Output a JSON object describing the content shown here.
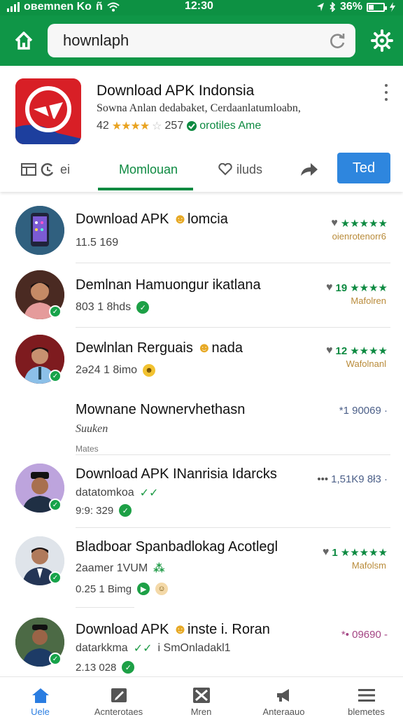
{
  "status_bar": {
    "carrier": "oвemnen Ko",
    "extra": "ñ",
    "time": "12:30",
    "battery": "36%",
    "battery_level": 0.36
  },
  "app_bar": {
    "search_value": "hownlaph"
  },
  "app": {
    "title": "Download APK Indonsia",
    "subtitle": "Sowna Anlan dedabaket, Cerdaanlatumloabn,",
    "rating": "42",
    "stars": "★★★★",
    "extra_star": "☆",
    "count": "257",
    "badge": "orotiles Ame"
  },
  "tabs": [
    {
      "label": "ei"
    },
    {
      "label": "Momlouan"
    },
    {
      "label": "iluds"
    },
    {
      "label": ""
    }
  ],
  "test_button": "Ted",
  "list": [
    {
      "title": "Download APK ",
      "title_emoji": "☻",
      "title_tail": "lomcia",
      "line2": "11.5 169",
      "rating_value": "",
      "rating_stars": "★★★★★",
      "rating_sub": "oienrotenorr6"
    },
    {
      "title": "Demlnan Hamuongur ikatlana",
      "line2": "803 1 8hds",
      "rating_value": "19",
      "rating_stars": "★★★★",
      "rating_sub": "Mafolren"
    },
    {
      "title": "Dewlnlan Rerguais ",
      "title_emoji": "☻",
      "title_tail": "nada",
      "line2": "2ə24 1 8imo",
      "rating_value": "12",
      "rating_stars": "★★★★",
      "rating_sub": "Wafolnanl"
    },
    {
      "title": "Mownane Nownervhethasn",
      "line2": "Suuken",
      "line3": "Mates",
      "rating_value": "*1 90069 ·"
    },
    {
      "title": "Download APK INanrisia Idarcks",
      "line2": "datatomkoa",
      "line2_tail": "✓✓",
      "line3": "9:9: 329",
      "rating_value": "1,51K9 8ł3 ·"
    },
    {
      "title": "Bladboar Spanbadlokag Acotlegl",
      "line2": "2aamer 1VUM",
      "line3": "0.25 1 Bimg",
      "rating_value": "1",
      "rating_stars": "★★★★★",
      "rating_sub": "Mafolsm"
    },
    {
      "title": "Download APK ",
      "title_emoji": "☻",
      "title_tail": "inste i. Roran",
      "line2": "datarkkma",
      "line2_tail": "✓✓",
      "line2_more": "i SmOnladakl1",
      "line3": "2.13 028",
      "rating_value": "*• 09690 -"
    }
  ],
  "bottom_nav": [
    {
      "label": "Uele",
      "icon": "home-icon",
      "active": true
    },
    {
      "label": "Acnterotaes",
      "icon": "edit-icon"
    },
    {
      "label": "Mren",
      "icon": "image-icon"
    },
    {
      "label": "Anteraauo",
      "icon": "megaphone-icon"
    },
    {
      "label": "blemetes",
      "icon": "menu-icon"
    }
  ],
  "colors": {
    "brand_green": "#0f9647",
    "accent_blue": "#2e86de",
    "star_gold": "#e9a321"
  }
}
